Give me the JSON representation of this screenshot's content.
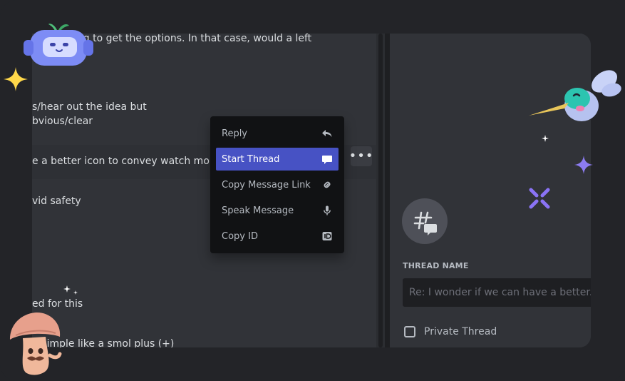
{
  "chat": {
    "lines": [
      "ght clicking to get the options. In that case, would a left",
      "s/hear out the idea but",
      "bvious/clear",
      "e a better icon to convey watch more b",
      "vid safety",
      "ed for this",
      "g simple like a smol plus (+)"
    ]
  },
  "message_actions": {
    "more_label": "•••"
  },
  "context_menu": {
    "items": [
      {
        "label": "Reply",
        "icon": "reply-icon"
      },
      {
        "label": "Start Thread",
        "icon": "thread-icon"
      },
      {
        "label": "Copy Message Link",
        "icon": "link-icon"
      },
      {
        "label": "Speak Message",
        "icon": "microphone-icon"
      },
      {
        "label": "Copy ID",
        "icon": "id-icon"
      }
    ],
    "active_index": 1
  },
  "thread_panel": {
    "icon": "thread-hash-icon",
    "name_label": "THREAD NAME",
    "name_placeholder": "Re: I wonder if we can have a better...",
    "private_label": "Private Thread",
    "private_checked": false
  },
  "colors": {
    "background": "#232428",
    "surface": "#313338",
    "menu": "#111214",
    "accent": "#4752c4"
  }
}
